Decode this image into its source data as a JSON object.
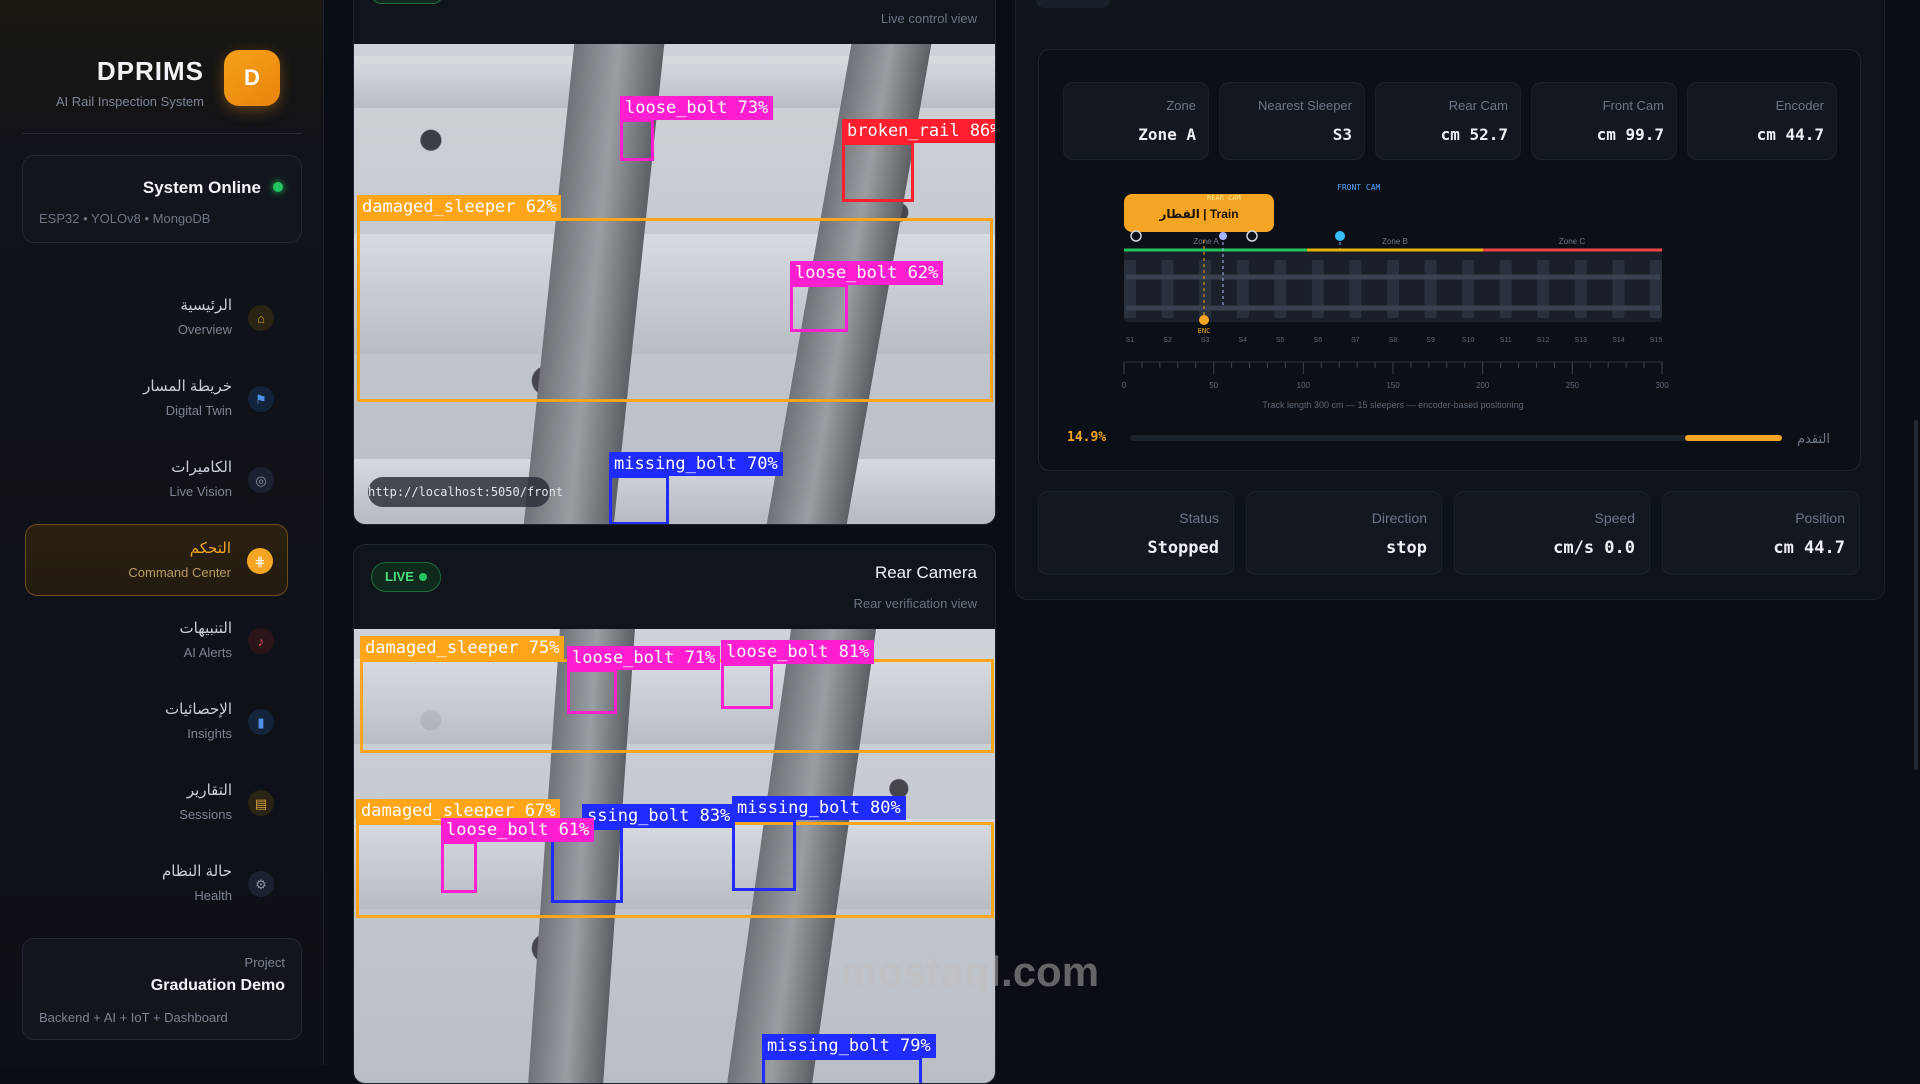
{
  "sidebar": {
    "brand": {
      "title": "DPRIMS",
      "subtitle": "AI Rail Inspection System",
      "logo_letter": "D"
    },
    "status": {
      "title": "System Online",
      "subtitle": "ESP32 • YOLOv8 • MongoDB"
    },
    "nav": [
      {
        "ar": "الرئيسية",
        "en": "Overview",
        "icon": "home-icon"
      },
      {
        "ar": "خريطة المسار",
        "en": "Digital Twin",
        "icon": "flag-icon"
      },
      {
        "ar": "الكاميرات",
        "en": "Live Vision",
        "icon": "camera-icon"
      },
      {
        "ar": "التحكم",
        "en": "Command Center",
        "icon": "sliders-icon",
        "active": true
      },
      {
        "ar": "التنبيهات",
        "en": "AI Alerts",
        "icon": "bell-icon"
      },
      {
        "ar": "الإحصائيات",
        "en": "Insights",
        "icon": "bar-chart-icon"
      },
      {
        "ar": "التقارير",
        "en": "Sessions",
        "icon": "document-icon"
      },
      {
        "ar": "حالة النظام",
        "en": "Health",
        "icon": "gear-icon"
      }
    ],
    "project": {
      "label": "Project",
      "title": "Graduation Demo",
      "subtitle": "Backend + AI + IoT + Dashboard"
    }
  },
  "front_camera": {
    "subtitle": "Live control view",
    "url": "http://localhost:5050/front",
    "detections": [
      {
        "label": "loose_bolt 73%",
        "color": "#ff1fd1"
      },
      {
        "label": "broken_rail 86%",
        "color": "#ff1f2e"
      },
      {
        "label": "damaged_sleeper 62%",
        "color": "#ffa51a"
      },
      {
        "label": "loose_bolt 62%",
        "color": "#ff1fd1"
      },
      {
        "label": "missing_bolt 70%",
        "color": "#1f2bff"
      }
    ]
  },
  "rear_camera": {
    "badge": "LIVE",
    "title": "Rear Camera",
    "subtitle": "Rear verification view",
    "detections": [
      {
        "label": "damaged_sleeper 75%",
        "color": "#ffa51a"
      },
      {
        "label": "loose_bolt 71%",
        "color": "#ff1fd1"
      },
      {
        "label": "loose_bolt 81%",
        "color": "#ff1fd1"
      },
      {
        "label": "damaged_sleeper 67%",
        "color": "#ffa51a"
      },
      {
        "label": "ssing_bolt 83%",
        "color": "#1f2bff"
      },
      {
        "label": "missing_bolt 80%",
        "color": "#1f2bff"
      },
      {
        "label": "loose_bolt 61%",
        "color": "#ff1fd1"
      },
      {
        "label": "missing_bolt 79%",
        "color": "#1f2bff"
      }
    ]
  },
  "digital_twin": {
    "metrics": [
      {
        "label": "Zone",
        "value": "Zone A"
      },
      {
        "label": "Nearest Sleeper",
        "value": "S3"
      },
      {
        "label": "Rear Cam",
        "value": "cm 52.7"
      },
      {
        "label": "Front Cam",
        "value": "cm 99.7"
      },
      {
        "label": "Encoder",
        "value": "cm 44.7"
      }
    ],
    "train_label": "القطار | Train",
    "rear_cam_tag": "REAR CAM",
    "front_cam_tag": "FRONT CAM",
    "zones": [
      "Zone A",
      "Zone B",
      "Zone C"
    ],
    "enc_tag": "ENC",
    "sleepers": [
      "S1",
      "S2",
      "S3",
      "S4",
      "S5",
      "S6",
      "S7",
      "S8",
      "S9",
      "S10",
      "S11",
      "S12",
      "S13",
      "S14",
      "S15"
    ],
    "ticks": [
      "0",
      "50",
      "100",
      "150",
      "200",
      "250",
      "300"
    ],
    "caption": "Track length 300 cm — 15 sleepers — encoder-based positioning",
    "progress": {
      "label": "التقدم",
      "percent_text": "14.9%",
      "value": 0.149
    }
  },
  "stats": [
    {
      "label": "Status",
      "value": "Stopped"
    },
    {
      "label": "Direction",
      "value": "stop"
    },
    {
      "label": "Speed",
      "value": "cm/s 0.0"
    },
    {
      "label": "Position",
      "value": "cm 44.7"
    }
  ],
  "watermark": "mostaql.com",
  "colors": {
    "accent": "#f5a524",
    "online": "#22c55e",
    "zone_a": "#22c55e",
    "zone_b": "#eab308",
    "zone_c": "#ef4444"
  }
}
